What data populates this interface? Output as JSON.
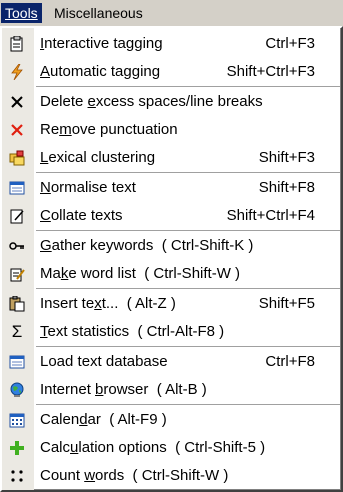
{
  "menubar": {
    "tools": "Tools",
    "misc": "Miscellaneous"
  },
  "items": [
    {
      "pre": "",
      "u": "I",
      "post": "nteractive tagging",
      "shortcut": "Ctrl+F3",
      "icon": "tag-clipboard-icon"
    },
    {
      "pre": "",
      "u": "A",
      "post": "utomatic tagging",
      "shortcut": "Shift+Ctrl+F3",
      "icon": "lightning-icon"
    },
    {
      "pre": "Delete ",
      "u": "e",
      "post": "xcess spaces/line breaks",
      "shortcut": "",
      "icon": "black-x-icon"
    },
    {
      "pre": "Re",
      "u": "m",
      "post": "ove punctuation",
      "shortcut": "",
      "icon": "red-x-icon"
    },
    {
      "pre": "",
      "u": "L",
      "post": "exical clustering",
      "shortcut": "Shift+F3",
      "icon": "folders-icon"
    },
    {
      "pre": "",
      "u": "N",
      "post": "ormalise text",
      "shortcut": "Shift+F8",
      "icon": "window-icon"
    },
    {
      "pre": "",
      "u": "C",
      "post": "ollate texts",
      "shortcut": "Shift+Ctrl+F4",
      "icon": "edit-doc-icon"
    },
    {
      "pre": "",
      "u": "G",
      "post": "ather keywords  ( Ctrl-Shift-K )",
      "shortcut": "",
      "icon": "key-icon"
    },
    {
      "pre": "Ma",
      "u": "k",
      "post": "e word list  ( Ctrl-Shift-W )",
      "shortcut": "",
      "icon": "notepad-pen-icon"
    },
    {
      "pre": "Insert te",
      "u": "x",
      "post": "t...  ( Alt-Z )",
      "shortcut": "Shift+F5",
      "icon": "paste-icon"
    },
    {
      "pre": "",
      "u": "T",
      "post": "ext statistics  ( Ctrl-Alt-F8 )",
      "shortcut": "",
      "icon": "sigma-icon"
    },
    {
      "pre": "Load text database",
      "u": "",
      "post": "",
      "shortcut": "Ctrl+F8",
      "icon": "window-icon"
    },
    {
      "pre": "Internet ",
      "u": "b",
      "post": "rowser  ( Alt-B )",
      "shortcut": "",
      "icon": "globe-icon"
    },
    {
      "pre": "Calen",
      "u": "d",
      "post": "ar  ( Alt-F9 )",
      "shortcut": "",
      "icon": "calendar-icon"
    },
    {
      "pre": "Calc",
      "u": "u",
      "post": "lation options  ( Ctrl-Shift-5 )",
      "shortcut": "",
      "icon": "plus-icon"
    },
    {
      "pre": "Count ",
      "u": "w",
      "post": "ords  ( Ctrl-Shift-W )",
      "shortcut": "",
      "icon": "dots-icon"
    }
  ]
}
